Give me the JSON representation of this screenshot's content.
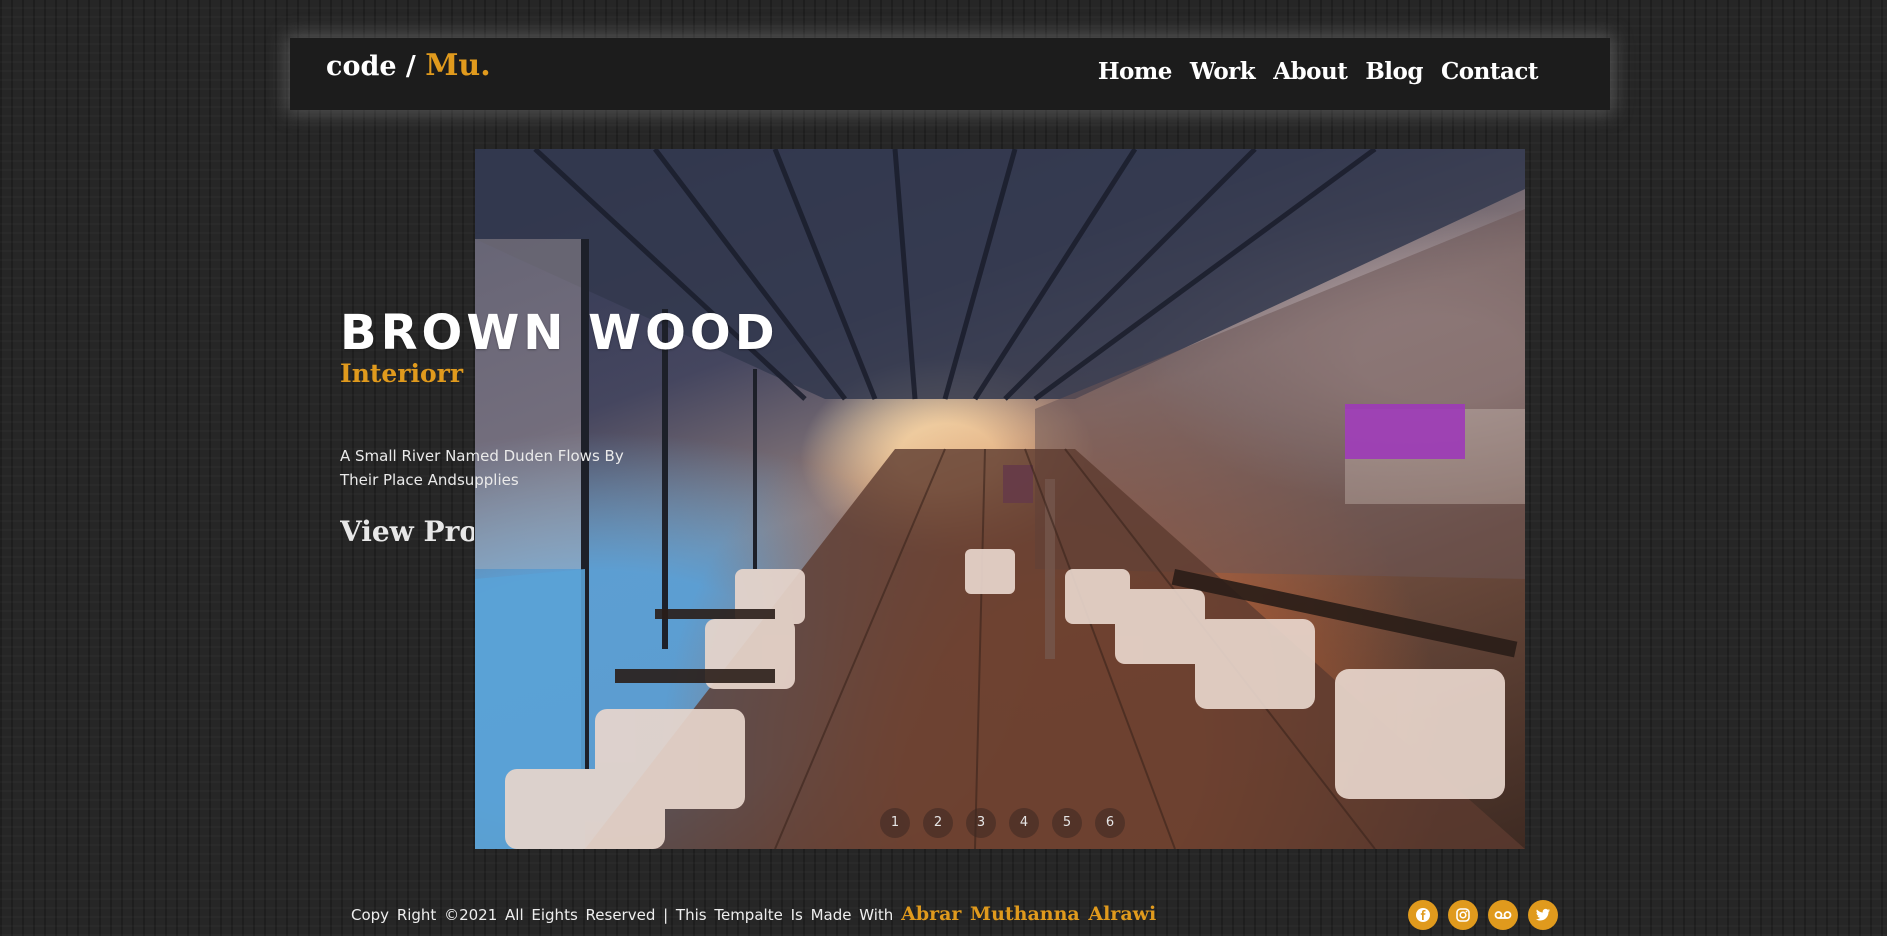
{
  "header": {
    "logo_prefix": "code /",
    "logo_accent": "Mu.",
    "nav": [
      "Home",
      "Work",
      "About",
      "Blog",
      "Contact"
    ]
  },
  "hero": {
    "title": "BROWN WOOD",
    "subtitle": "Interiorr",
    "description": "A Small River Named Duden Flows By Their Place Andsupplies",
    "button": "View Project",
    "image_icon": "restaurant-interior-photo",
    "pager": [
      "1",
      "2",
      "3",
      "4",
      "5",
      "6"
    ]
  },
  "footer": {
    "text": "Copy Right ©2021 All Eights Reserved | This Tempalte Is Made With",
    "author": "Abrar Muthanna Alrawi",
    "socials": [
      "facebook-icon",
      "instagram-icon",
      "voicemail-icon",
      "twitter-icon"
    ]
  },
  "colors": {
    "accent": "#e09a1d",
    "background": "#262626",
    "navbar": "#1c1c1c"
  }
}
